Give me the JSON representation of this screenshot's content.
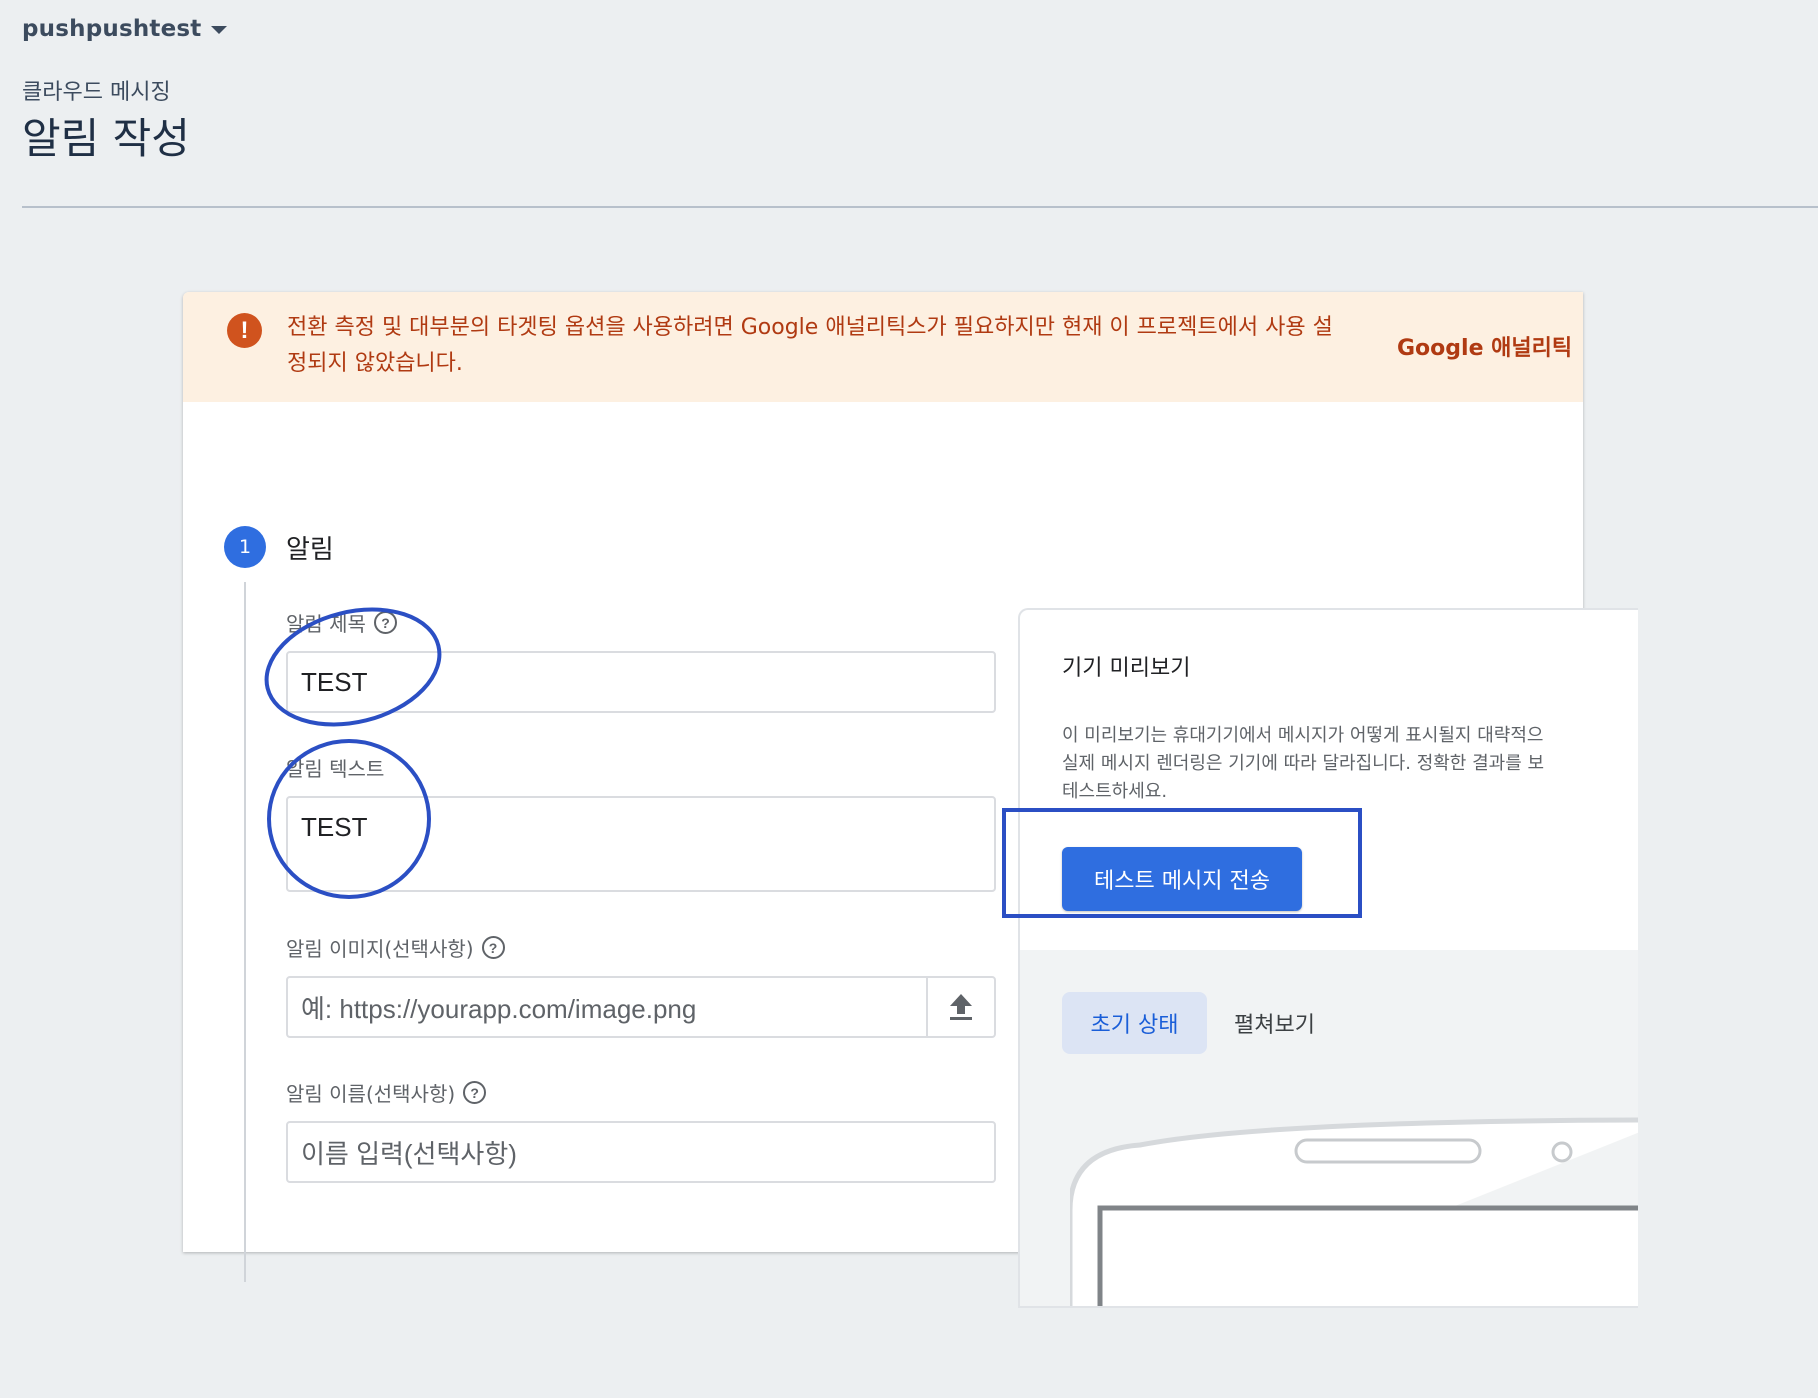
{
  "header": {
    "project_name": "pushpushtest",
    "breadcrumb": "클라우드 메시징",
    "page_title": "알림 작성"
  },
  "warning": {
    "text": "전환 측정 및 대부분의 타겟팅 옵션을 사용하려면 Google 애널리틱스가 필요하지만 현재 이 프로젝트에서 사용 설정되지 않았습니다.",
    "link_label": "Google 애널리틱"
  },
  "step": {
    "number": "1",
    "title": "알림"
  },
  "form": {
    "title_label": "알림 제목",
    "title_value": "TEST",
    "text_label": "알림 텍스트",
    "text_value": "TEST",
    "image_label": "알림 이미지(선택사항)",
    "image_placeholder": "예: https://yourapp.com/image.png",
    "name_label": "알림 이름(선택사항)",
    "name_placeholder": "이름 입력(선택사항)"
  },
  "preview": {
    "title": "기기 미리보기",
    "description_lines": [
      "이 미리보기는 휴대기기에서 메시지가 어떻게 표시될지 대략적으",
      "실제 메시지 렌더링은 기기에 따라 달라집니다. 정확한 결과를 보",
      "테스트하세요."
    ],
    "test_button": "테스트 메시지 전송",
    "tab_initial": "초기 상태",
    "tab_expanded": "펼쳐보기"
  },
  "icons": {
    "warning": "exclamation-icon",
    "help": "question-mark-icon",
    "upload": "upload-icon",
    "dropdown": "caret-down-icon"
  },
  "colors": {
    "primary": "#2f6ee0",
    "warning_bg": "#fdf0e1",
    "warning_text": "#b03a12",
    "annotation": "#2b4fc4"
  }
}
